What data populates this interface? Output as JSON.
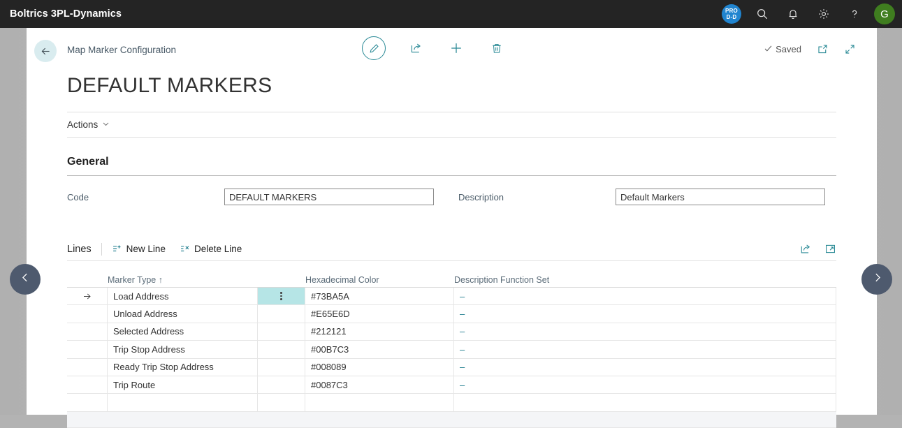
{
  "topbar": {
    "brand": "Boltrics 3PL-Dynamics",
    "env_badge_line1": "PRO",
    "env_badge_line2": "D-D",
    "icons": [
      "search-icon",
      "notification-bell-icon",
      "settings-gear-icon",
      "help-question-icon"
    ],
    "avatar_initial": "G",
    "background_color": "#242424",
    "badge_color": "#2185d0",
    "avatar_color": "#3f7d1f"
  },
  "page_header": {
    "back_label": "",
    "breadcrumb": "Map Marker Configuration",
    "saved_status": "Saved",
    "accent_color": "#2a8a96"
  },
  "title": "DEFAULT MARKERS",
  "actions": {
    "label": "Actions"
  },
  "general": {
    "section_title": "General",
    "code": {
      "label": "Code",
      "value": "DEFAULT MARKERS",
      "placeholder": ""
    },
    "description": {
      "label": "Description",
      "value": "Default Markers",
      "placeholder": ""
    }
  },
  "lines": {
    "title": "Lines",
    "new_line": "New Line",
    "delete_line": "Delete Line",
    "columns": {
      "marker_type": "Marker Type ↑",
      "hex_color": "Hexadecimal Color",
      "desc_function_set": "Description Function Set"
    },
    "rows": [
      {
        "marker_type": "Load Address",
        "hex_color": "#73BA5A",
        "desc_function_set": "–"
      },
      {
        "marker_type": "Unload Address",
        "hex_color": "#E65E6D",
        "desc_function_set": "–"
      },
      {
        "marker_type": "Selected Address",
        "hex_color": "#212121",
        "desc_function_set": "–"
      },
      {
        "marker_type": "Trip Stop Address",
        "hex_color": "#00B7C3",
        "desc_function_set": "–"
      },
      {
        "marker_type": "Ready Trip Stop Address",
        "hex_color": "#008089",
        "desc_function_set": "–"
      },
      {
        "marker_type": "Trip Route",
        "hex_color": "#0087C3",
        "desc_function_set": "–"
      },
      {
        "marker_type": "",
        "hex_color": "",
        "desc_function_set": ""
      }
    ],
    "selected_row_index": 0,
    "selection_highlight_color": "#b6e5e6"
  },
  "navigation": {
    "prev": "previous-record",
    "next": "next-record"
  }
}
